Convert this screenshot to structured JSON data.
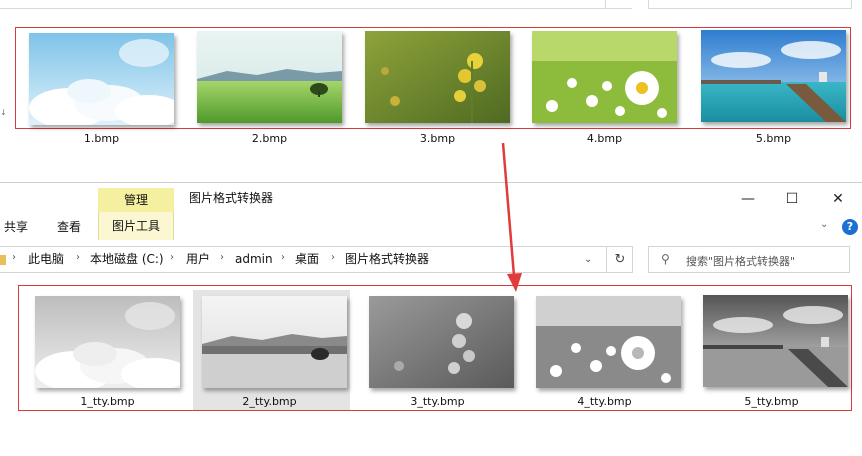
{
  "top_files": [
    {
      "name": "1.bmp"
    },
    {
      "name": "2.bmp"
    },
    {
      "name": "3.bmp"
    },
    {
      "name": "4.bmp"
    },
    {
      "name": "5.bmp"
    }
  ],
  "ribbon": {
    "share": "共享",
    "view": "查看",
    "manage": "管理",
    "picture_tools": "图片工具"
  },
  "window": {
    "title": "图片格式转换器",
    "minimize": "—",
    "maximize": "☐",
    "close": "✕",
    "help": "?"
  },
  "breadcrumbs": [
    "此电脑",
    "本地磁盘 (C:)",
    "用户",
    "admin",
    "桌面",
    "图片格式转换器"
  ],
  "search": {
    "placeholder": "搜索\"图片格式转换器\""
  },
  "bottom_files": [
    {
      "name": "1_tty.bmp"
    },
    {
      "name": "2_tty.bmp"
    },
    {
      "name": "3_tty.bmp"
    },
    {
      "name": "4_tty.bmp"
    },
    {
      "name": "5_tty.bmp"
    }
  ],
  "colors": {
    "highlight_box": "#d93a3a",
    "arrow": "#e03c3c",
    "manage_tab": "#f5f0a0"
  }
}
